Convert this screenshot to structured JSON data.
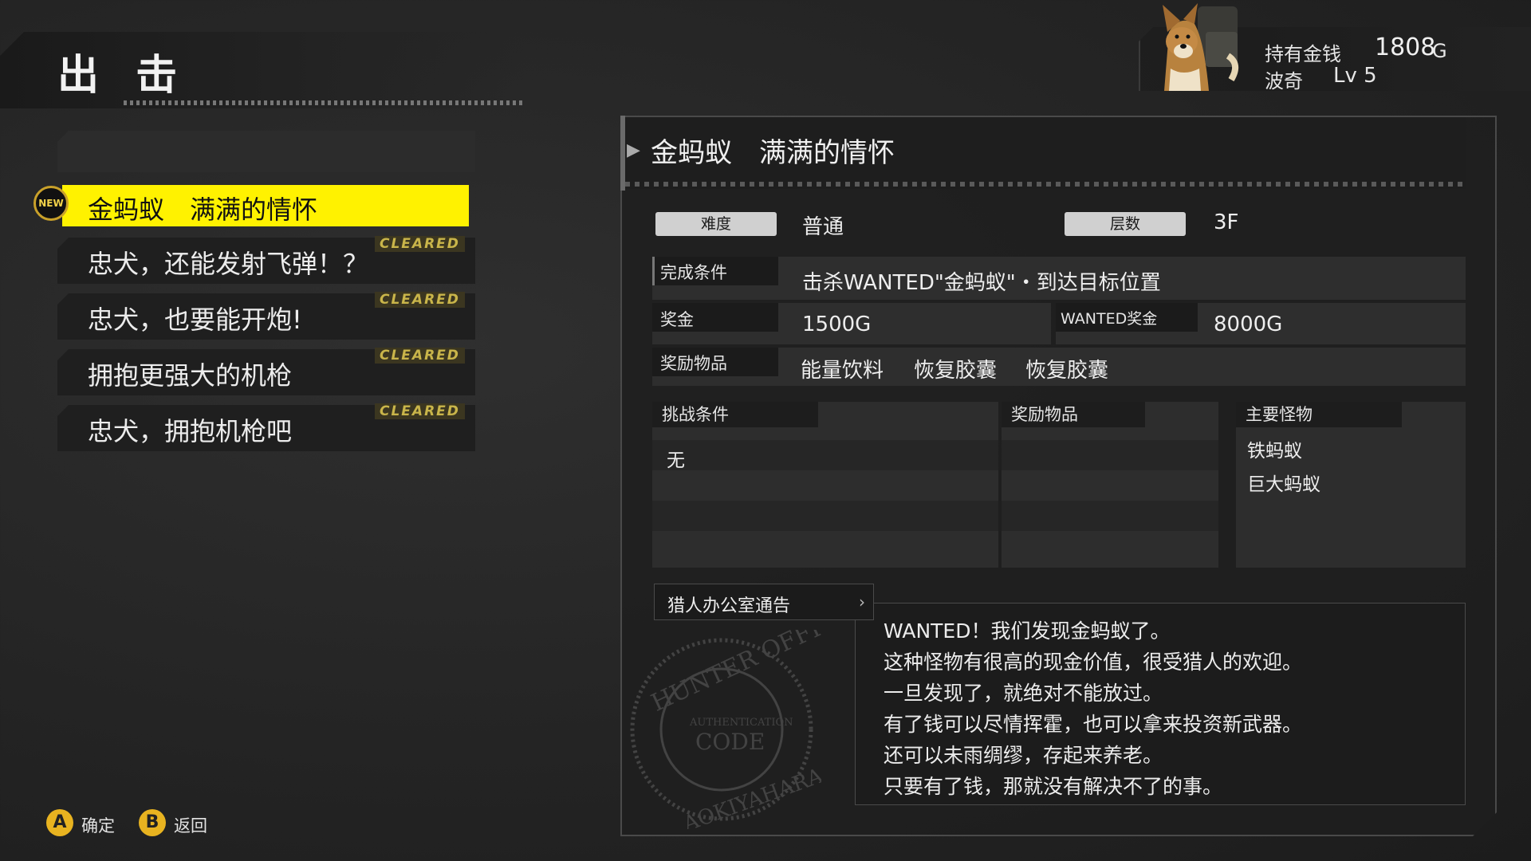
{
  "header": {
    "title": "出 击"
  },
  "player": {
    "money_label": "持有金钱",
    "money_value": "1808",
    "money_unit": "G",
    "name": "波奇",
    "level": "Lv 5"
  },
  "missions": [
    {
      "label": "金蚂蚁　满满的情怀",
      "status": "NEW",
      "selected": true
    },
    {
      "label": "忠犬，还能发射飞弹！？",
      "status": "CLEARED"
    },
    {
      "label": "忠犬，也要能开炮!",
      "status": "CLEARED"
    },
    {
      "label": "拥抱更强大的机枪",
      "status": "CLEARED"
    },
    {
      "label": "忠犬，拥抱机枪吧",
      "status": "CLEARED"
    }
  ],
  "detail": {
    "title": "金蚂蚁　满满的情怀",
    "difficulty_label": "难度",
    "difficulty_value": "普通",
    "floors_label": "层数",
    "floors_value": "3F",
    "completion_label": "完成条件",
    "completion_value": "击杀WANTED\"金蚂蚁\"・到达目标位置",
    "reward_label": "奖金",
    "reward_value": "1500G",
    "wanted_reward_label": "WANTED奖金",
    "wanted_reward_value": "8000G",
    "items_label": "奖励物品",
    "items": [
      "能量饮料",
      "恢复胶囊",
      "恢复胶囊"
    ],
    "challenge_header": "挑战条件",
    "challenge_value": "无",
    "challenge_items_header": "奖励物品",
    "monsters_header": "主要怪物",
    "monsters": [
      "铁蚂蚁",
      "巨大蚂蚁"
    ],
    "notice_tab": "猎人办公室通告",
    "notice_lines": [
      "WANTED！我们发现金蚂蚁了。",
      "这种怪物有很高的现金价值，很受猎人的欢迎。",
      "一旦发现了，就绝对不能放过。",
      "有了钱可以尽情挥霍，也可以拿来投资新武器。",
      "还可以未雨绸缪，存起来养老。",
      "只要有了钱，那就没有解决不了的事。"
    ],
    "stamp_text": [
      "HUNTER OFFICE",
      "AUTHENTICATION",
      "CODE",
      "AOKIYAHARA"
    ]
  },
  "footer": {
    "confirm_key": "A",
    "confirm_label": "确定",
    "back_key": "B",
    "back_label": "返回"
  },
  "colors": {
    "highlight": "#fff200",
    "button": "#e8b320",
    "cleared": "#c9b54a"
  }
}
